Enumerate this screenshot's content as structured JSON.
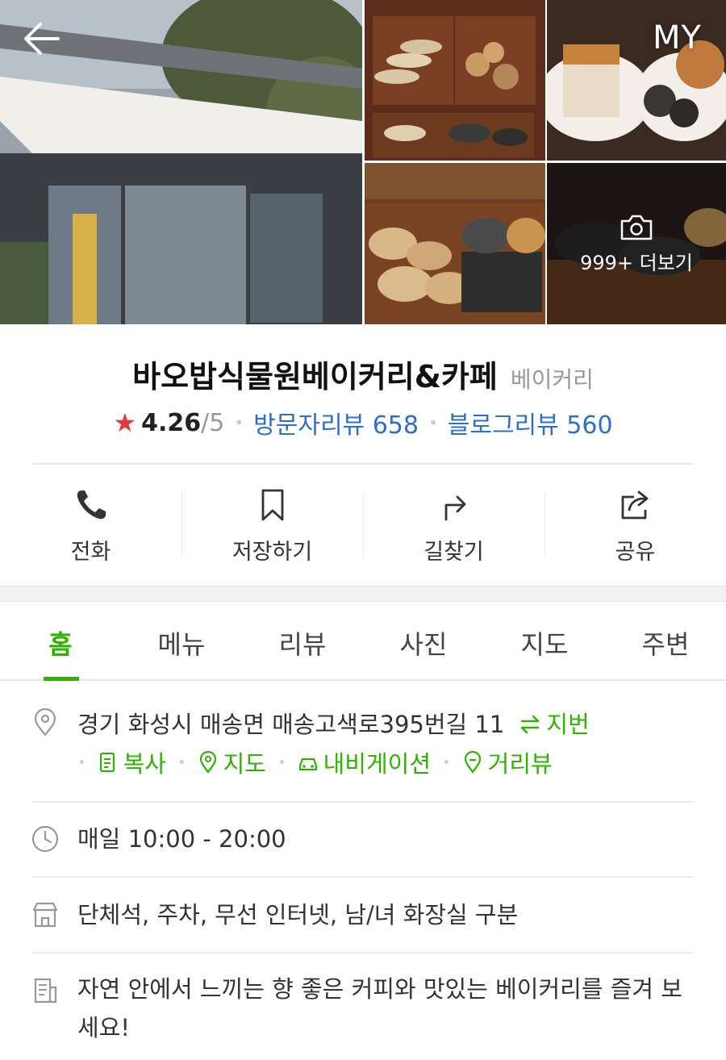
{
  "header": {
    "my_label": "MY",
    "more_photos_label": "999+ 더보기"
  },
  "place": {
    "name": "바오밥식물원베이커리&카페",
    "category": "베이커리",
    "rating": "4.26",
    "rating_max": "/5",
    "visitor_reviews": "방문자리뷰 658",
    "blog_reviews": "블로그리뷰 560"
  },
  "actions": [
    {
      "label": "전화",
      "icon": "phone-icon"
    },
    {
      "label": "저장하기",
      "icon": "bookmark-icon"
    },
    {
      "label": "길찾기",
      "icon": "directions-icon"
    },
    {
      "label": "공유",
      "icon": "share-icon"
    }
  ],
  "tabs": [
    "홈",
    "메뉴",
    "리뷰",
    "사진",
    "지도",
    "주변"
  ],
  "active_tab": "홈",
  "info": {
    "address": "경기 화성시 매송면 매송고색로395번길 11",
    "jibun_label": "지번",
    "links": [
      "복사",
      "지도",
      "내비게이션",
      "거리뷰"
    ],
    "hours": "매일 10:00 - 20:00",
    "facilities": "단체석, 주차, 무선 인터넷, 남/녀 화장실 구분",
    "description": "자연 안에서 느끼는 향 좋은 커피와 맛있는 베이커리를 즐겨 보세요!"
  },
  "colors": {
    "accent_green": "#2db400",
    "link_blue": "#2c6fce",
    "star_red": "#e5383b"
  }
}
